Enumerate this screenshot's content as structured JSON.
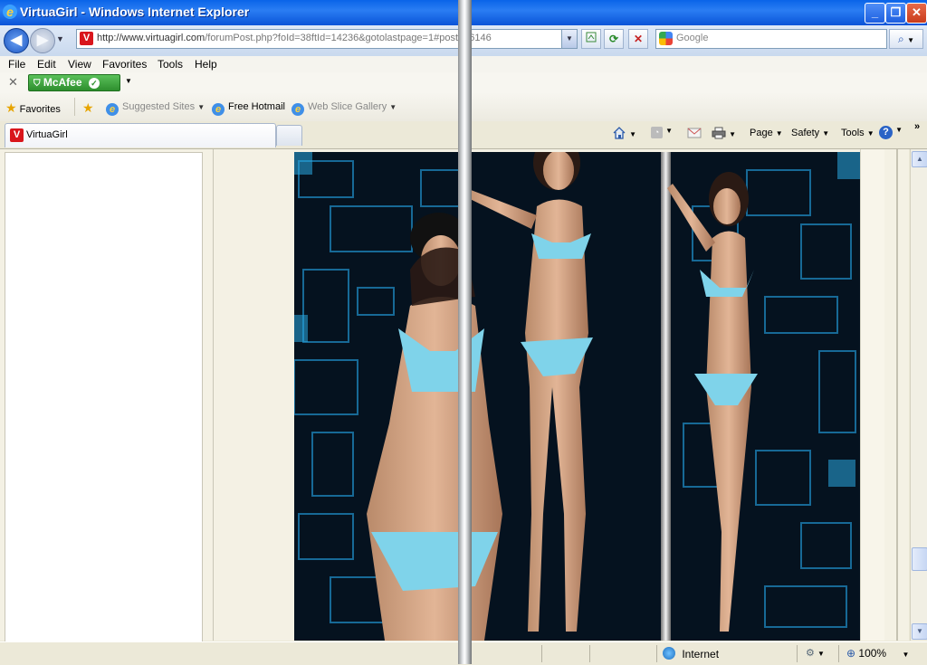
{
  "window": {
    "title": "VirtuaGirl - Windows Internet Explorer",
    "minimize": "_",
    "maximize": "❐",
    "close": "✕"
  },
  "nav": {
    "back_glyph": "◀",
    "forward_glyph": "▶",
    "site_icon_letter": "V",
    "url_domain": "http://www.virtuagirl.com",
    "url_path": "/forumPost.php?foId=38ftId=14236&gotolastpage=1#post256146",
    "search_placeholder": "Google"
  },
  "menubar": [
    "File",
    "Edit",
    "View",
    "Favorites",
    "Tools",
    "Help"
  ],
  "mcafee": {
    "label": "McAfee",
    "check": "✓"
  },
  "favorites_bar": {
    "favorites_label": "Favorites",
    "items": [
      "Suggested Sites",
      "Free Hotmail",
      "Web Slice Gallery"
    ]
  },
  "tab": {
    "label": "VirtuaGirl",
    "icon_letter": "V"
  },
  "commandbar": {
    "page": "Page",
    "safety": "Safety",
    "tools": "Tools"
  },
  "statusbar": {
    "zone": "Internet",
    "zoom": "100%"
  },
  "colors": {
    "accent": "#0a64e8",
    "photo_bg": "#05121f",
    "bikini": "#7fd3ea"
  },
  "icons": [
    "ie-icon",
    "home-icon",
    "feeds-icon",
    "mail-icon",
    "print-icon",
    "help-icon",
    "globe-icon",
    "refresh-icon",
    "stop-icon",
    "search-icon"
  ]
}
